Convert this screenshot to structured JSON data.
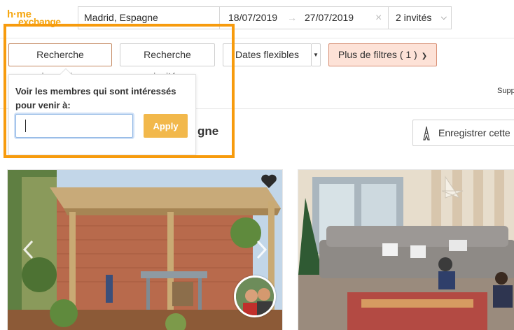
{
  "brand": {
    "logo_line1": "h·me",
    "logo_line2": "exchange",
    "color": "#f5a60f"
  },
  "search": {
    "location": "Madrid, Espagne",
    "date_from": "18/07/2019",
    "date_arrow": "→",
    "date_to": "27/07/2019",
    "clear_icon": "×",
    "guests": "2 invités"
  },
  "filters": {
    "reverse": "Recherche inversée",
    "guests": "Recherche invités",
    "flexible": "Dates flexibles",
    "more": "Plus de filtres ( 1 )"
  },
  "popover": {
    "title": "Voir les membres qui sont intéressés pour venir à:",
    "input_value": "",
    "apply": "Apply"
  },
  "results": {
    "headline_fragment": "gne",
    "save_label": "Enregistrer cette",
    "side_label": "Supp"
  },
  "colors": {
    "accent": "#f79b0d",
    "apply_bg": "#f2b84b",
    "more_bg": "#fde2d7"
  }
}
